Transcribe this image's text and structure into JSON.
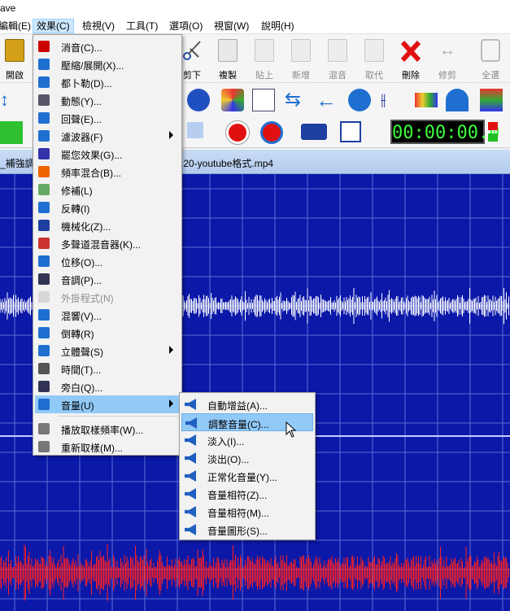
{
  "window": {
    "title_fragment": "ave"
  },
  "menubar": {
    "items": [
      {
        "label": "編輯(E)"
      },
      {
        "label": "效果(C)"
      },
      {
        "label": "檢視(V)"
      },
      {
        "label": "工具(T)"
      },
      {
        "label": "選項(O)"
      },
      {
        "label": "視窗(W)"
      },
      {
        "label": "說明(H)"
      }
    ]
  },
  "toolbar": {
    "open": "開啟",
    "cut": "剪下",
    "copy": "複製",
    "paste": "貼上",
    "new": "新增",
    "mix": "混音",
    "replace": "取代",
    "delete": "刪除",
    "trim": "修剪",
    "select_all": "全選"
  },
  "timer": "00:00:00.0",
  "tab": {
    "left_fragment": "_補強調",
    "filename": ".20-youtube格式.mp4"
  },
  "effects_menu": {
    "items": [
      {
        "label": "消音(C)...",
        "icon": "mute-icon"
      },
      {
        "label": "壓縮/展開(X)...",
        "icon": "compress-icon"
      },
      {
        "label": "都卜勒(D)...",
        "icon": "doppler-icon"
      },
      {
        "label": "動態(Y)...",
        "icon": "dynamics-icon"
      },
      {
        "label": "回聲(E)...",
        "icon": "echo-icon"
      },
      {
        "label": "濾波器(F)",
        "icon": "filter-icon",
        "submenu": true
      },
      {
        "label": "罷您效果(G)...",
        "icon": "effect-icon"
      },
      {
        "label": "頻率混合(B)...",
        "icon": "freq-mix-icon"
      },
      {
        "label": "修補(L)",
        "icon": "repair-icon"
      },
      {
        "label": "反轉(I)",
        "icon": "invert-icon"
      },
      {
        "label": "機械化(Z)...",
        "icon": "mechanize-icon"
      },
      {
        "label": "多聲道混音器(K)...",
        "icon": "multichannel-icon"
      },
      {
        "label": "位移(O)...",
        "icon": "shift-icon"
      },
      {
        "label": "音調(P)...",
        "icon": "pitch-icon"
      },
      {
        "label": "外掛程式(N)",
        "icon": "plugin-icon",
        "disabled": true
      },
      {
        "label": "混響(V)...",
        "icon": "reverb-icon"
      },
      {
        "label": "倒轉(R)",
        "icon": "reverse-icon"
      },
      {
        "label": "立體聲(S)",
        "icon": "stereo-icon",
        "submenu": true
      },
      {
        "label": "時間(T)...",
        "icon": "clock-icon"
      },
      {
        "label": "旁白(Q)...",
        "icon": "narration-icon"
      },
      {
        "label": "音量(U)",
        "icon": "volume-icon",
        "submenu": true,
        "highlighted": true
      },
      {
        "label": "播放取樣頻率(W)...",
        "icon": "playback-rate-icon"
      },
      {
        "label": "重新取樣(M)...",
        "icon": "resample-icon"
      }
    ]
  },
  "volume_menu": {
    "items": [
      {
        "label": "自動增益(A)...",
        "icon": "auto-gain-icon"
      },
      {
        "label": "調整音量(C)...",
        "icon": "adjust-volume-icon",
        "highlighted": true
      },
      {
        "label": "淡入(I)...",
        "icon": "fade-in-icon"
      },
      {
        "label": "淡出(O)...",
        "icon": "fade-out-icon"
      },
      {
        "label": "正常化音量(Y)...",
        "icon": "normalize-icon"
      },
      {
        "label": "音量相符(Z)...",
        "icon": "match-volume-icon"
      },
      {
        "label": "音量相符(M)...",
        "icon": "match-volume-2-icon"
      },
      {
        "label": "音量圖形(S)...",
        "icon": "volume-shape-icon"
      }
    ]
  },
  "colors": {
    "wave_bg": "#0b18a8",
    "wave_top": "#ffffff",
    "wave_bottom": "#ff2020",
    "menu_highlight": "#91c9f7"
  }
}
